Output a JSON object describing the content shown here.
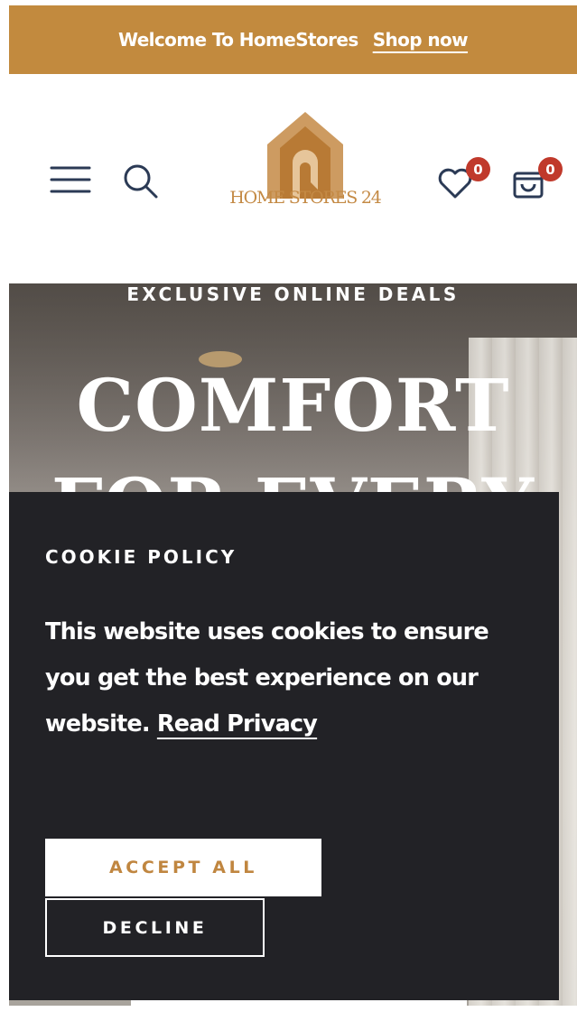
{
  "announcement": {
    "text": "Welcome To HomeStores",
    "link_label": "Shop now"
  },
  "header": {
    "logo_text": "HOME STORES 24",
    "wishlist_count": "0",
    "cart_count": "0",
    "icons": [
      "menu-icon",
      "search-icon",
      "heart-icon",
      "shopping-bag-icon"
    ]
  },
  "hero": {
    "eyebrow": "EXCLUSIVE ONLINE DEALS",
    "title_line1": "COMFORT",
    "title_line2": "FOR EVERY"
  },
  "cookie": {
    "title": "COOKIE POLICY",
    "message": "This website uses cookies to ensure you get the best experience on our website.",
    "link_label": "Read Privacy",
    "accept_label": "ACCEPT ALL",
    "decline_label": "DECLINE"
  },
  "colors": {
    "brand_gold": "#c28a3e",
    "cookie_bg": "#222226",
    "badge_red": "#c0392b",
    "icon_navy": "#2b3a55"
  }
}
